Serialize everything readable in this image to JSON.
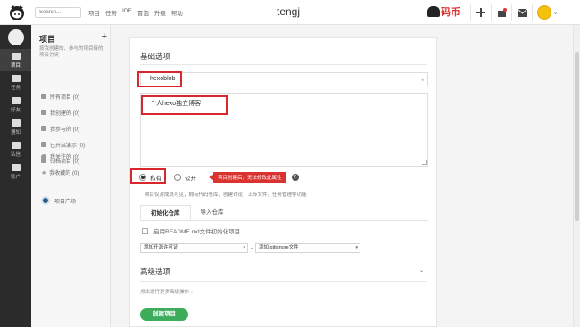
{
  "topbar": {
    "search_placeholder": "Search...",
    "nav": [
      "项目",
      "任务",
      "IDE",
      "冒泡",
      "升级",
      "帮助"
    ],
    "username": "tengj",
    "coin_label": "码币"
  },
  "leftnav": {
    "items": [
      {
        "label": "项目",
        "active": true
      },
      {
        "label": "任务",
        "active": false
      },
      {
        "label": "好友",
        "active": false
      },
      {
        "label": "通知",
        "active": false
      },
      {
        "label": "私信",
        "active": false
      },
      {
        "label": "账户",
        "active": false
      }
    ]
  },
  "sidebar": {
    "title": "项目",
    "description": "按我创建的、参与的项目待的项目分类",
    "items": [
      {
        "label": "所有项目 (0)"
      },
      {
        "label": "我创建的 (0)"
      },
      {
        "label": "我参与的 (0)"
      },
      {
        "label": "已开启演示 (0)"
      },
      {
        "label": "归档项目 (0)"
      }
    ],
    "items2": [
      {
        "label": "我关注的 (0)"
      },
      {
        "label": "我收藏的 (0)"
      }
    ],
    "plaza": "项目广场"
  },
  "form": {
    "section_basic": "基础选项",
    "project_name": "hexoblob",
    "required_mark": "*",
    "description": "个人hexo独立博客",
    "visibility_private": "私有",
    "visibility_public": "公开",
    "tip": "项目创建后，无法修改此属性",
    "help": "?",
    "visibility_desc": "项目仅对成员可见，拥有代码仓库，创建讨论，上传文件，任务管理等功能",
    "tabs": [
      "初始化仓库",
      "导入仓库"
    ],
    "readme_label": "启用README.md文件初始化项目",
    "license_select": "添加开源许可证",
    "dash": "-",
    "gitignore_select": "添加.gitignore文件",
    "section_advanced": "高级选项",
    "advanced_desc": "点击进行更多高级操作...",
    "create_button": "创建项目"
  }
}
